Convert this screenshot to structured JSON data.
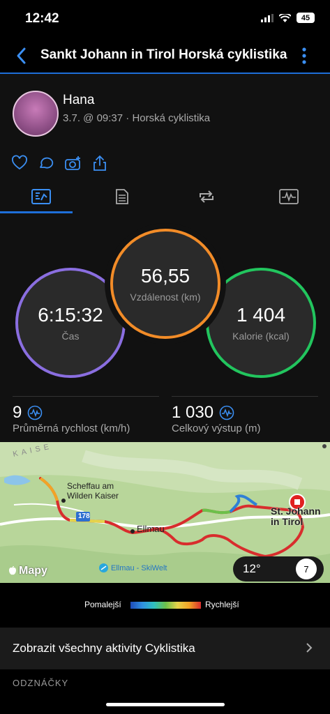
{
  "status": {
    "time": "12:42",
    "battery": "45"
  },
  "nav": {
    "title": "Sankt Johann in Tirol Horská cyklistika"
  },
  "profile": {
    "name": "Hana",
    "subtitle": "3.7. @ 09:37 · Horská cyklistika"
  },
  "actions": [
    "heart-icon",
    "comment-icon",
    "camera-icon",
    "share-icon"
  ],
  "tabs": [
    "stats-tab",
    "details-tab",
    "laps-tab",
    "chart-tab"
  ],
  "circles": {
    "time": {
      "value": "6:15:32",
      "label": "Čas",
      "color": "#8a6ee0"
    },
    "distance": {
      "value": "56,55",
      "label": "Vzdálenost (km)",
      "color": "#f28c28"
    },
    "calories": {
      "value": "1 404",
      "label": "Kalorie (kcal)",
      "color": "#22c55e"
    }
  },
  "metrics": {
    "speed": {
      "value": "9",
      "label": "Průměrná rychlost (km/h)"
    },
    "ascent": {
      "value": "1 030",
      "label": "Celkový výstup (m)"
    }
  },
  "map": {
    "labels": {
      "scheffau1": "Scheffau am",
      "scheffau2": "Wilden Kaiser",
      "road": "178",
      "ellmau": "Ellmau",
      "stjohann1": "St. Johann",
      "stjohann2": "in Tirol",
      "kaiser": "KAISE",
      "skiwelt": "Ellmau - SkiWelt",
      "attribution": "Mapy"
    },
    "weather": {
      "temp": "12°",
      "wind": "7"
    }
  },
  "legend": {
    "slow": "Pomalejší",
    "fast": "Rychlejší"
  },
  "link": {
    "label": "Zobrazit všechny aktivity Cyklistika"
  },
  "section": {
    "title": "ODZNÁČKY"
  }
}
